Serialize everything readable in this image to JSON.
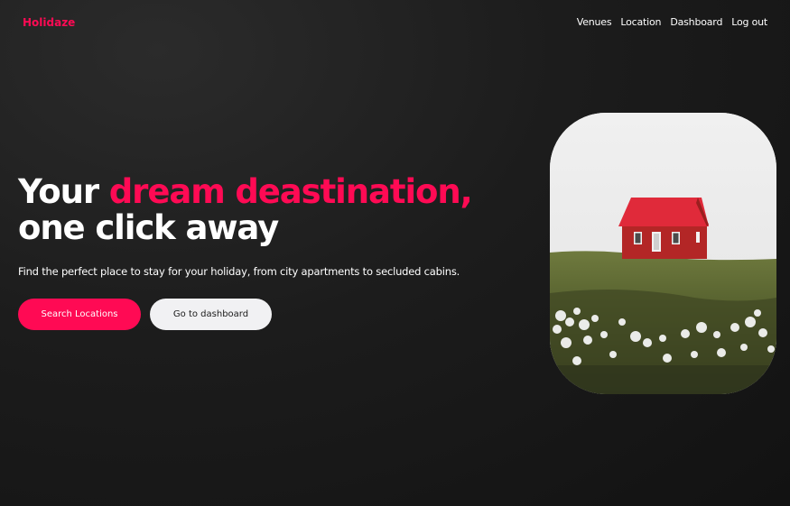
{
  "header": {
    "logo": "Holidaze",
    "nav": [
      {
        "label": "Venues"
      },
      {
        "label": "Location"
      },
      {
        "label": "Dashboard"
      },
      {
        "label": "Log out"
      }
    ]
  },
  "hero": {
    "title_part1": "Your ",
    "title_accent": "dream deastination,",
    "title_part2": "one click away",
    "subtitle": "Find the perfect place to stay for your holiday, from city apartments to secluded cabins.",
    "primary_button": "Search Locations",
    "secondary_button": "Go to dashboard",
    "image": "red-cabin-on-hill-photo"
  },
  "colors": {
    "accent": "#ff0a54",
    "background": "#1c1c1c",
    "secondary_button_bg": "#f1f1f3"
  }
}
